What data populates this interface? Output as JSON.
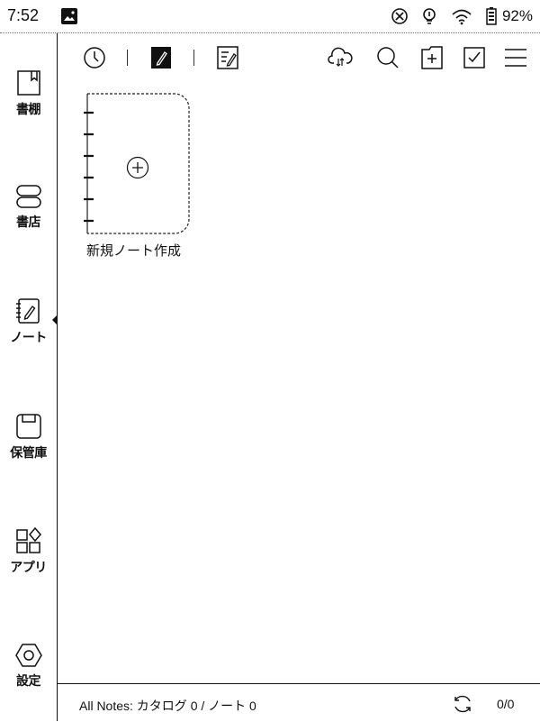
{
  "status_bar": {
    "time": "7:52",
    "battery": "92%"
  },
  "sidebar": {
    "items": [
      {
        "label": "書棚"
      },
      {
        "label": "書店"
      },
      {
        "label": "ノート"
      },
      {
        "label": "保管庫"
      },
      {
        "label": "アプリ"
      },
      {
        "label": "設定"
      }
    ],
    "active_item": "ノート"
  },
  "toolbar": {
    "icons": [
      "clock-icon",
      "notebook-icon",
      "note-list-icon",
      "cloud-sync-icon",
      "search-icon",
      "new-folder-icon",
      "select-icon",
      "menu-icon"
    ],
    "active_icon": "notebook-icon"
  },
  "main": {
    "new_note_label": "新規ノート作成"
  },
  "footer": {
    "summary": "All Notes: カタログ 0 / ノート 0",
    "page": "0/0"
  }
}
